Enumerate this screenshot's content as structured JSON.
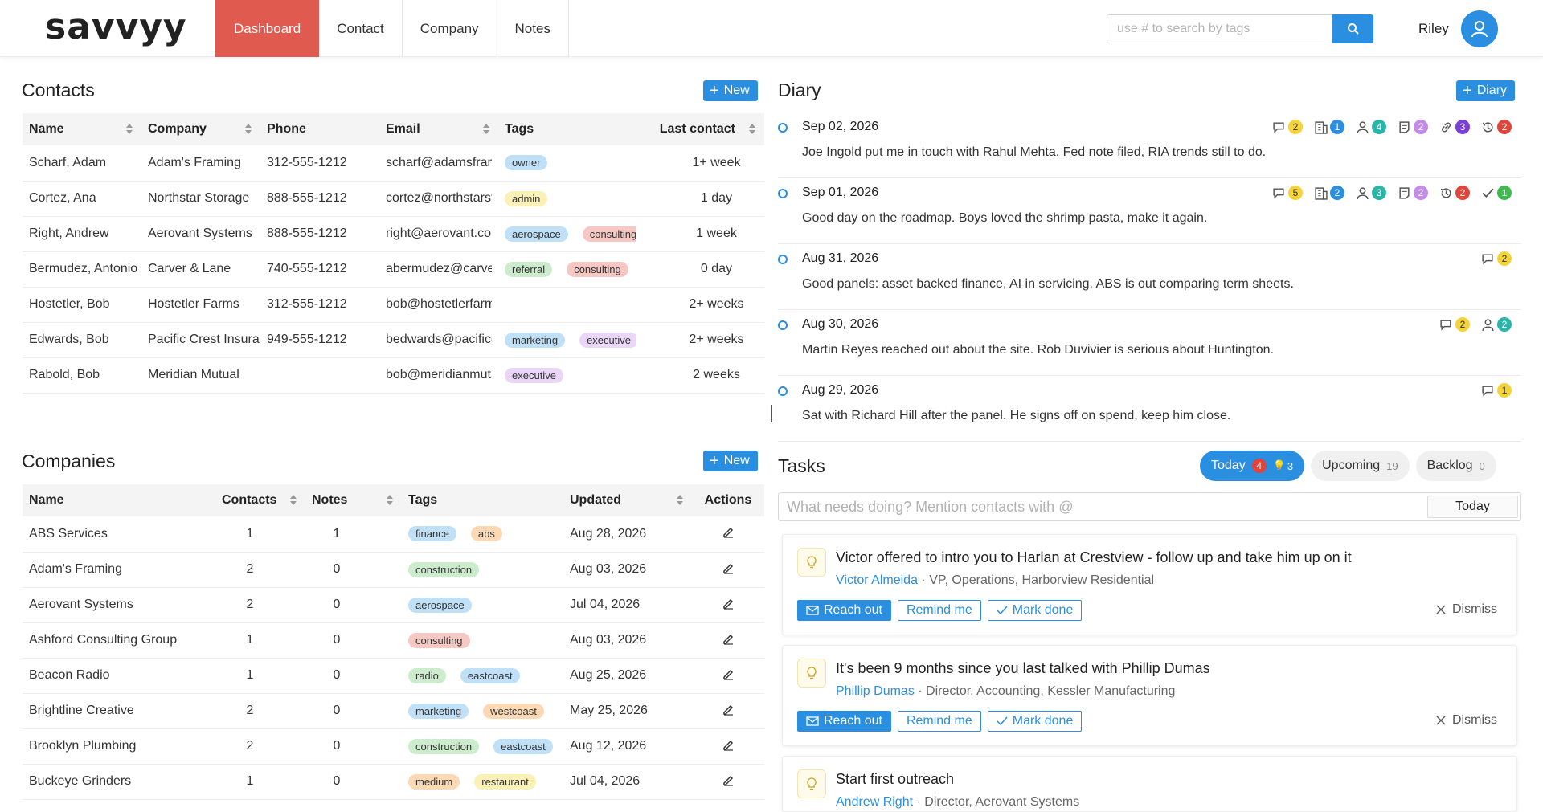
{
  "header": {
    "logo": "savvyy",
    "nav": [
      "Dashboard",
      "Contact",
      "Company",
      "Notes"
    ],
    "search_placeholder": "use # to search by tags",
    "user_name": "Riley"
  },
  "contacts": {
    "title": "Contacts",
    "new_label": "New",
    "columns": [
      "Name",
      "Company",
      "Phone",
      "Email",
      "Tags",
      "Last contact"
    ],
    "rows": [
      {
        "name": "Scharf, Adam",
        "company": "Adam's Framing",
        "phone": "312-555-1212",
        "email": "scharf@adamsframing",
        "tags": [
          {
            "label": "owner",
            "color": "blue"
          }
        ],
        "last": "1+ week"
      },
      {
        "name": "Cortez, Ana",
        "company": "Northstar Storage",
        "phone": "888-555-1212",
        "email": "cortez@northstarstorage",
        "tags": [
          {
            "label": "admin",
            "color": "yellow"
          }
        ],
        "last": "1 day"
      },
      {
        "name": "Right, Andrew",
        "company": "Aerovant Systems",
        "phone": "888-555-1212",
        "email": "right@aerovant.com",
        "tags": [
          {
            "label": "aerospace",
            "color": "blue"
          },
          {
            "label": "consulting",
            "color": "red"
          }
        ],
        "last": "1 week"
      },
      {
        "name": "Bermudez, Antonio",
        "company": "Carver & Lane",
        "phone": "740-555-1212",
        "email": "abermudez@carverlane",
        "tags": [
          {
            "label": "referral",
            "color": "green"
          },
          {
            "label": "consulting",
            "color": "red"
          }
        ],
        "last": "0 day"
      },
      {
        "name": "Hostetler, Bob",
        "company": "Hostetler Farms",
        "phone": "312-555-1212",
        "email": "bob@hostetlerfarms",
        "tags": [],
        "last": "2+ weeks"
      },
      {
        "name": "Edwards, Bob",
        "company": "Pacific Crest Insurance",
        "phone": "949-555-1212",
        "email": "bedwards@pacificcrest",
        "tags": [
          {
            "label": "marketing",
            "color": "blue"
          },
          {
            "label": "executive",
            "color": "purple"
          }
        ],
        "last": "2+ weeks"
      },
      {
        "name": "Rabold, Bob",
        "company": "Meridian Mutual",
        "phone": "",
        "email": "bob@meridianmutual",
        "tags": [
          {
            "label": "executive",
            "color": "purple"
          }
        ],
        "last": "2 weeks"
      }
    ]
  },
  "companies": {
    "title": "Companies",
    "new_label": "New",
    "columns": [
      "Name",
      "Contacts",
      "Notes",
      "Tags",
      "Updated",
      "Actions"
    ],
    "rows": [
      {
        "name": "ABS Services",
        "contacts": "1",
        "notes": "1",
        "tags": [
          {
            "label": "finance",
            "color": "blue"
          },
          {
            "label": "abs",
            "color": "orange"
          }
        ],
        "updated": "Aug 28, 2026"
      },
      {
        "name": "Adam's Framing",
        "contacts": "2",
        "notes": "0",
        "tags": [
          {
            "label": "construction",
            "color": "green"
          }
        ],
        "updated": "Aug 03, 2026"
      },
      {
        "name": "Aerovant Systems",
        "contacts": "2",
        "notes": "0",
        "tags": [
          {
            "label": "aerospace",
            "color": "blue"
          }
        ],
        "updated": "Jul 04, 2026"
      },
      {
        "name": "Ashford Consulting Group",
        "contacts": "1",
        "notes": "0",
        "tags": [
          {
            "label": "consulting",
            "color": "red"
          }
        ],
        "updated": "Aug 03, 2026"
      },
      {
        "name": "Beacon Radio",
        "contacts": "1",
        "notes": "0",
        "tags": [
          {
            "label": "radio",
            "color": "green"
          },
          {
            "label": "eastcoast",
            "color": "blue"
          }
        ],
        "updated": "Aug 25, 2026"
      },
      {
        "name": "Brightline Creative",
        "contacts": "2",
        "notes": "0",
        "tags": [
          {
            "label": "marketing",
            "color": "blue"
          },
          {
            "label": "westcoast",
            "color": "orange"
          }
        ],
        "updated": "May 25, 2026"
      },
      {
        "name": "Brooklyn Plumbing",
        "contacts": "2",
        "notes": "0",
        "tags": [
          {
            "label": "construction",
            "color": "green"
          },
          {
            "label": "eastcoast",
            "color": "blue"
          }
        ],
        "updated": "Aug 12, 2026"
      },
      {
        "name": "Buckeye Grinders",
        "contacts": "1",
        "notes": "0",
        "tags": [
          {
            "label": "medium",
            "color": "orange"
          },
          {
            "label": "restaurant",
            "color": "yellow"
          }
        ],
        "updated": "Jul 04, 2026"
      }
    ]
  },
  "diary": {
    "title": "Diary",
    "new_label": "Diary",
    "entries": [
      {
        "date": "Sep 02, 2026",
        "text": "Joe Ingold put me in touch with Rahul Mehta. Fed note filed, RIA trends still to do.",
        "badges": [
          {
            "icon": "chat-icon",
            "count": "2",
            "color": "yellow"
          },
          {
            "icon": "building-icon",
            "count": "1",
            "color": "blue"
          },
          {
            "icon": "person-icon",
            "count": "4",
            "color": "teal"
          },
          {
            "icon": "note-icon",
            "count": "2",
            "color": "purple"
          },
          {
            "icon": "link-icon",
            "count": "3",
            "color": "violet"
          },
          {
            "icon": "history-icon",
            "count": "2",
            "color": "red"
          }
        ]
      },
      {
        "date": "Sep 01, 2026",
        "text": "Good day on the roadmap. Boys loved the shrimp pasta, make it again.",
        "badges": [
          {
            "icon": "chat-icon",
            "count": "5",
            "color": "yellow"
          },
          {
            "icon": "building-icon",
            "count": "2",
            "color": "blue"
          },
          {
            "icon": "person-icon",
            "count": "3",
            "color": "teal"
          },
          {
            "icon": "note-icon",
            "count": "2",
            "color": "purple"
          },
          {
            "icon": "history-icon",
            "count": "2",
            "color": "red"
          },
          {
            "icon": "check-icon",
            "count": "1",
            "color": "green"
          }
        ]
      },
      {
        "date": "Aug 31, 2026",
        "text": "Good panels: asset backed finance, AI in servicing. ABS is out comparing term sheets.",
        "badges": [
          {
            "icon": "chat-icon",
            "count": "2",
            "color": "yellow"
          }
        ]
      },
      {
        "date": "Aug 30, 2026",
        "text": "Martin Reyes reached out about the site. Rob Duvivier is serious about Huntington.",
        "badges": [
          {
            "icon": "chat-icon",
            "count": "2",
            "color": "yellow"
          },
          {
            "icon": "person-icon",
            "count": "2",
            "color": "teal"
          }
        ]
      },
      {
        "date": "Aug 29, 2026",
        "text": "Sat with Richard Hill after the panel. He signs off on spend, keep him close.",
        "badges": [
          {
            "icon": "chat-icon",
            "count": "1",
            "color": "yellow"
          }
        ]
      }
    ]
  },
  "tasks": {
    "title": "Tasks",
    "tabs": {
      "today": {
        "label": "Today",
        "count": "4",
        "bulb_count": "3"
      },
      "upcoming": {
        "label": "Upcoming",
        "count": "19"
      },
      "backlog": {
        "label": "Backlog",
        "count": "0"
      }
    },
    "input_placeholder": "What needs doing? Mention contacts with @",
    "today_btn": "Today",
    "actions": {
      "reach": "Reach out",
      "remind": "Remind me",
      "done": "Mark done",
      "dismiss": "Dismiss"
    },
    "cards": [
      {
        "title": "Victor offered to intro you to Harlan at Crestview - follow up and take him up on it",
        "person": "Victor Almeida",
        "detail": "VP, Operations, Harborview Residential"
      },
      {
        "title": "It's been 9 months since you last talked with Phillip Dumas",
        "person": "Phillip Dumas",
        "detail": "Director, Accounting, Kessler Manufacturing"
      },
      {
        "title": "Start first outreach",
        "person": "Andrew Right",
        "detail": "Director, Aerovant Systems"
      }
    ]
  },
  "colors": {
    "accent": "#2a8fe0",
    "active_nav": "#e05a4f"
  }
}
